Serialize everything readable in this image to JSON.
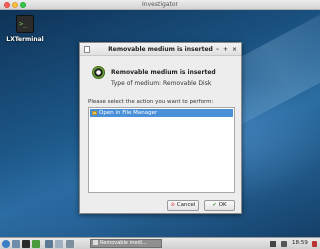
{
  "window": {
    "title": "Investigator"
  },
  "desktop": {
    "icon_label": "LXTerminal",
    "icon_glyph": ">_"
  },
  "dialog": {
    "title": "Removable medium is inserted",
    "heading": "Removable medium is inserted",
    "type_label": "Type of medium:",
    "type_value": "Removable Disk",
    "prompt": "Please select the action you want to perform:",
    "actions": [
      {
        "label": "Open in File Manager",
        "selected": true
      }
    ],
    "cancel_label": "Cancel",
    "ok_label": "OK",
    "controls": {
      "minimize": "–",
      "maximize": "+",
      "close": "×"
    }
  },
  "taskbar": {
    "task_label": "Removable medi...",
    "clock": "18:59"
  },
  "colors": {
    "selection": "#4a90d9",
    "desktop": "#1b4f7a"
  },
  "icons": {
    "desktop": "terminal-icon",
    "dialog": "usb-disk-icon",
    "action": "folder-icon",
    "cancel": "cancel-icon",
    "ok": "check-icon"
  }
}
